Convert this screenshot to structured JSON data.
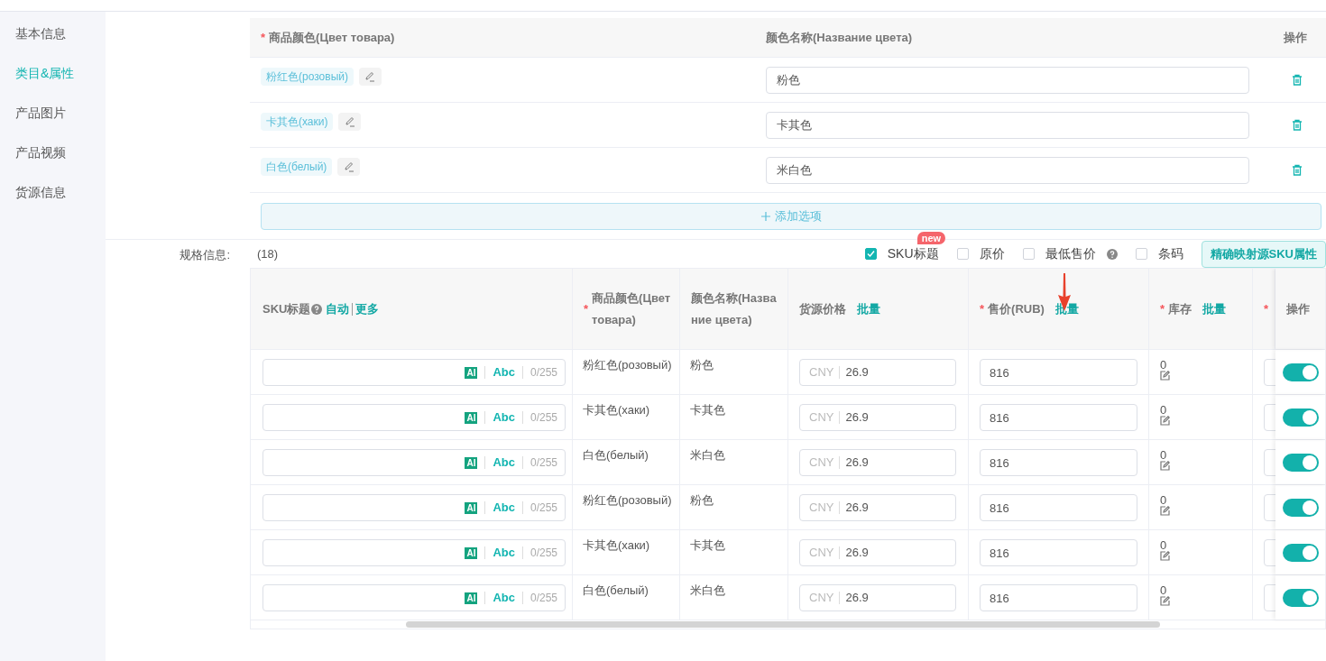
{
  "sidebar": {
    "items": [
      {
        "label": "基本信息",
        "selected": false
      },
      {
        "label": "类目&属性",
        "selected": true
      },
      {
        "label": "产品图片",
        "selected": false
      },
      {
        "label": "产品视频",
        "selected": false
      },
      {
        "label": "货源信息",
        "selected": false
      }
    ]
  },
  "color_table": {
    "columns": [
      {
        "mark": "*",
        "label": "商品颜色(Цвет товара)"
      },
      {
        "label": "颜色名称(Название цвета)"
      },
      {
        "label": "操作"
      }
    ],
    "rows": [
      {
        "tag": "粉红色(розовый)",
        "name": "粉色"
      },
      {
        "tag": "卡其色(хаки)",
        "name": "卡其色"
      },
      {
        "tag": "白色(белый)",
        "name": "米白色"
      }
    ],
    "add_button": "添加选项"
  },
  "spec": {
    "label": "规格信息:",
    "count": "(18)",
    "options": [
      {
        "label": "SKU标题",
        "checked": true,
        "badge": "new"
      },
      {
        "label": "原价",
        "checked": false
      },
      {
        "label": "最低售价",
        "checked": false,
        "help": true
      },
      {
        "label": "条码",
        "checked": false
      }
    ],
    "map_button": "精确映射源SKU属性"
  },
  "sku_table": {
    "columns": [
      {
        "label": "SKU标题",
        "help": true,
        "actions": [
          "自动",
          "更多"
        ]
      },
      {
        "mark": "*",
        "label": "商品颜色(Цвет товара)"
      },
      {
        "label": "颜色名称(Название цвета)"
      },
      {
        "label": "货源价格",
        "actions": [
          "批量"
        ]
      },
      {
        "mark": "*",
        "label": "售价(RUB)",
        "actions": [
          "批量"
        ]
      },
      {
        "mark": "*",
        "label": "库存",
        "actions": [
          "批量"
        ]
      },
      {
        "mark": "*"
      },
      {
        "label": "操作"
      }
    ],
    "rows": [
      {
        "ai": "AI",
        "abc": "Abc",
        "counter": "0/255",
        "color_label": "粉红色(розовый)",
        "name": "粉色",
        "currency": "CNY",
        "source_price": "26.9",
        "price": "816",
        "stock": "0",
        "enabled": true
      },
      {
        "ai": "AI",
        "abc": "Abc",
        "counter": "0/255",
        "color_label": "卡其色(хаки)",
        "name": "卡其色",
        "currency": "CNY",
        "source_price": "26.9",
        "price": "816",
        "stock": "0",
        "enabled": true
      },
      {
        "ai": "AI",
        "abc": "Abc",
        "counter": "0/255",
        "color_label": "白色(белый)",
        "name": "米白色",
        "currency": "CNY",
        "source_price": "26.9",
        "price": "816",
        "stock": "0",
        "enabled": true
      },
      {
        "ai": "AI",
        "abc": "Abc",
        "counter": "0/255",
        "color_label": "粉红色(розовый)",
        "name": "粉色",
        "currency": "CNY",
        "source_price": "26.9",
        "price": "816",
        "stock": "0",
        "enabled": true
      },
      {
        "ai": "AI",
        "abc": "Abc",
        "counter": "0/255",
        "color_label": "卡其色(хаки)",
        "name": "卡其色",
        "currency": "CNY",
        "source_price": "26.9",
        "price": "816",
        "stock": "0",
        "enabled": true
      },
      {
        "ai": "AI",
        "abc": "Abc",
        "counter": "0/255",
        "color_label": "白色(белый)",
        "name": "米白色",
        "currency": "CNY",
        "source_price": "26.9",
        "price": "816",
        "stock": "0",
        "enabled": true
      }
    ]
  }
}
